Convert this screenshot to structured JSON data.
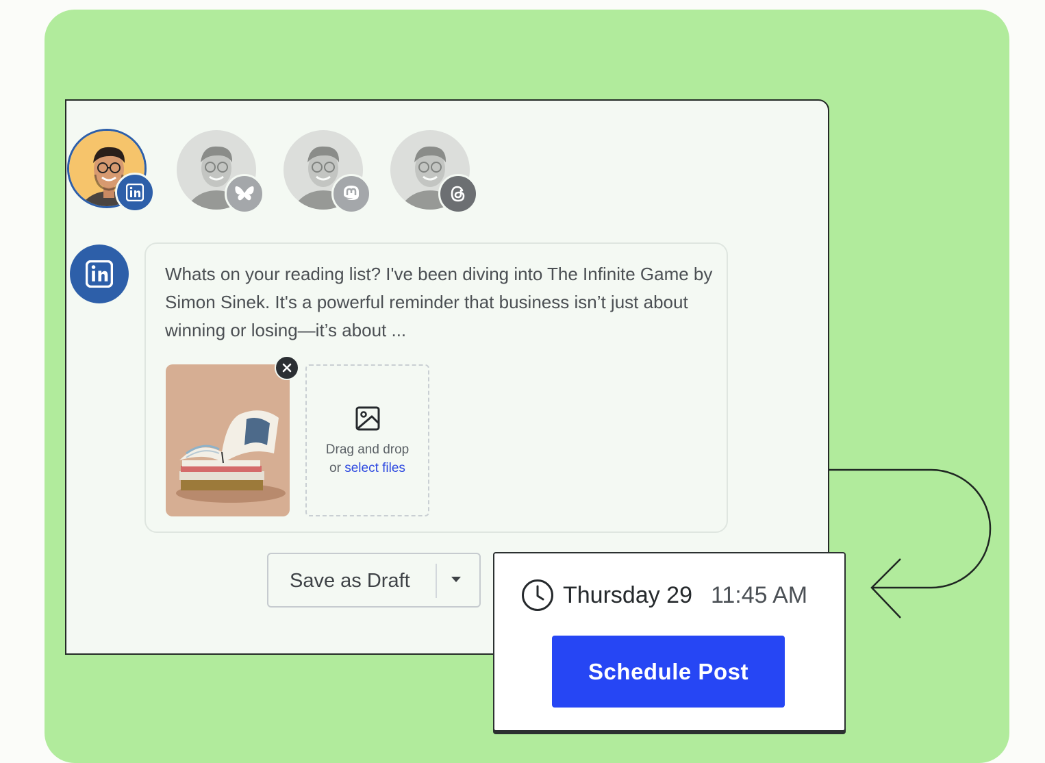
{
  "colors": {
    "background": "#fbfcf9",
    "card_green": "#b1eb9c",
    "linkedin_blue": "#2d5fa9",
    "primary_button": "#2646f4",
    "link": "#2c48e0"
  },
  "accounts": [
    {
      "network": "LinkedIn",
      "icon": "linkedin-icon",
      "selected": true
    },
    {
      "network": "Bluesky",
      "icon": "bluesky-icon",
      "selected": false
    },
    {
      "network": "Mastodon",
      "icon": "mastodon-icon",
      "selected": false
    },
    {
      "network": "Threads",
      "icon": "threads-icon",
      "selected": false
    }
  ],
  "composer": {
    "active_network_icon": "linkedin-icon",
    "post_text": "Whats on your reading list? I've been diving into The Infinite Game by Simon Sinek. It's a powerful reminder that business isn’t just about winning or losing—it’s about ...",
    "attachment_icon": "book-photo",
    "remove_icon": "close-icon",
    "dropzone": {
      "icon": "image-icon",
      "line1": "Drag and drop",
      "line2_prefix": "or",
      "link": "select files"
    }
  },
  "actions": {
    "draft_label": "Save as Draft",
    "draft_caret_icon": "caret-down-icon"
  },
  "schedule": {
    "clock_icon": "clock-icon",
    "day": "Thursday 29",
    "time": "11:45 AM",
    "button_label": "Schedule Post"
  }
}
